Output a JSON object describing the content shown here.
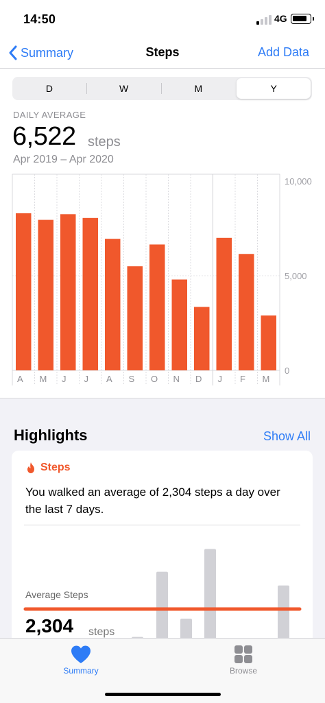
{
  "status": {
    "time": "14:50",
    "network": "4G"
  },
  "nav": {
    "back_label": "Summary",
    "title": "Steps",
    "action_label": "Add Data"
  },
  "segments": [
    "D",
    "W",
    "M",
    "Y"
  ],
  "selected_segment": "Y",
  "summary": {
    "label": "DAILY AVERAGE",
    "value": "6,522",
    "unit": "steps",
    "range": "Apr 2019 – Apr 2020"
  },
  "colors": {
    "accent": "#f0582c",
    "link": "#2e7cf6",
    "muted_bar": "#d1d1d6"
  },
  "chart_data": {
    "type": "bar",
    "categories": [
      "A",
      "M",
      "J",
      "J",
      "A",
      "S",
      "O",
      "N",
      "D",
      "J",
      "F",
      "M"
    ],
    "values": [
      8300,
      7950,
      8250,
      8050,
      6950,
      5500,
      6650,
      4800,
      3350,
      7000,
      6150,
      2900
    ],
    "y_ticks": [
      "10,000",
      "5,000",
      "0"
    ],
    "ylim": [
      0,
      10000
    ],
    "grid": true,
    "color": "#f0582c"
  },
  "highlights": {
    "title": "Highlights",
    "show_all": "Show All",
    "card": {
      "category": "Steps",
      "text": "You walked an average of 2,304 steps a day over the last 7 days.",
      "avg_label": "Average Steps",
      "avg_value": "2,304",
      "avg_unit": "steps",
      "mini_bars": [
        500,
        6200,
        2100,
        8200,
        5000
      ]
    }
  },
  "tabbar": {
    "summary_label": "Summary",
    "browse_label": "Browse"
  }
}
